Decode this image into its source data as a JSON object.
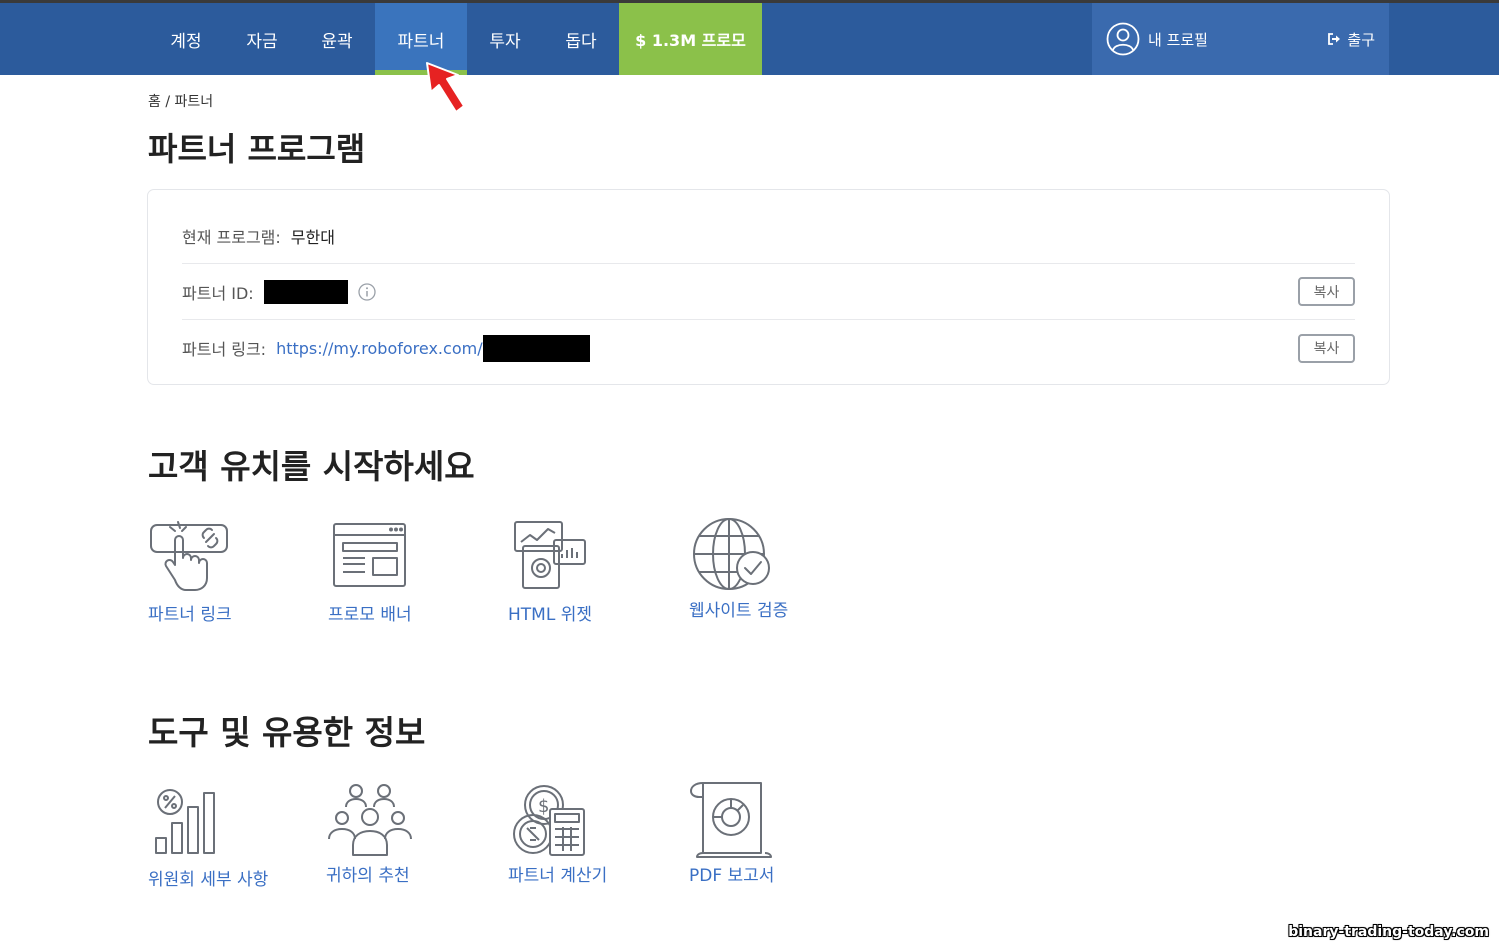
{
  "nav": {
    "items": [
      {
        "label": "계정"
      },
      {
        "label": "자금"
      },
      {
        "label": "윤곽"
      },
      {
        "label": "파트너"
      },
      {
        "label": "투자"
      },
      {
        "label": "돕다"
      }
    ],
    "promo_label": "$ 1.3M 프로모",
    "profile_label": "내 프로필",
    "logout_label": "출구",
    "colors": {
      "bar": "#2c5b9c",
      "active": "#3a74bd",
      "accent": "#8bc14a"
    }
  },
  "breadcrumb": {
    "home": "홈",
    "separator": " / ",
    "current": "파트너"
  },
  "page_title": "파트너 프로그램",
  "program": {
    "current_label": "현재 프로그램:",
    "current_value": "무한대",
    "id_label": "파트너 ID:",
    "link_label": "파트너 링크:",
    "link_value": "https://my.roboforex.com/",
    "copy_label": "복사"
  },
  "attract": {
    "title": "고객 유치를 시작하세요",
    "tiles": [
      {
        "label": "파트너 링크",
        "icon": "tap-link-icon"
      },
      {
        "label": "프로모 배너",
        "icon": "banner-icon"
      },
      {
        "label": "HTML 위젯",
        "icon": "widget-icon"
      },
      {
        "label": "웹사이트 검증",
        "icon": "globe-check-icon"
      }
    ]
  },
  "tools": {
    "title": "도구 및 유용한 정보",
    "tiles": [
      {
        "label": "위원회 세부 사항",
        "icon": "commission-chart-icon"
      },
      {
        "label": "귀하의 추천",
        "icon": "referrals-group-icon"
      },
      {
        "label": "파트너 계산기",
        "icon": "calculator-coins-icon"
      },
      {
        "label": "PDF 보고서",
        "icon": "pdf-report-icon"
      }
    ]
  },
  "watermark": "binary-trading-today.com"
}
